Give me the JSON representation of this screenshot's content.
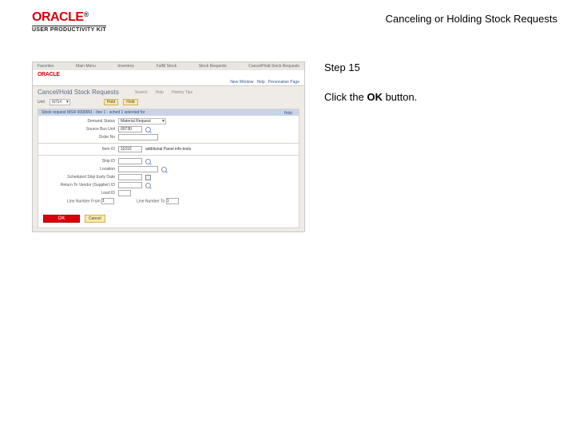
{
  "header": {
    "brand": "ORACLE",
    "subbrand": "USER PRODUCTIVITY KIT",
    "title": "Canceling or Holding Stock Requests"
  },
  "instruction": {
    "step_label": "Step 15",
    "text_pre": "Click the ",
    "bold": "OK",
    "text_post": " button."
  },
  "shot": {
    "menu_items": [
      "Favorites",
      "Main Menu",
      "Inventory",
      "Fulfill Stock",
      "Stock Requests",
      "Cancel/Hold Stock Requests"
    ],
    "brand": "ORACLE",
    "sub_links": [
      "New Window",
      "Help",
      "Personalize Page"
    ],
    "page_title": "Cancel/Hold Stock Requests",
    "tabs": [
      "Search",
      "Help",
      "History Tips"
    ],
    "bar_unit_label": "Unit",
    "bar_unit_value": "W/S4",
    "bar_buttons": [
      "Hold",
      "Hold"
    ],
    "form_header": "Stock request MSR 0000001 - line 1 - sched 1 selected for",
    "right_link": "Help",
    "rows": {
      "demand_status": {
        "label": "Demand Status",
        "value": "Material Request"
      },
      "source_bu": {
        "label": "Source Bus Unit",
        "value": "00730"
      },
      "order_no": {
        "label": "Order No"
      },
      "item_id": {
        "label": "Item ID",
        "value": "11010",
        "note": "additional Panel info-tests"
      },
      "ship_id": {
        "label": "Ship ID"
      },
      "location": {
        "label": "Location"
      },
      "sched_ship": {
        "label": "Scheduled Ship Early Date"
      },
      "rtv_id": {
        "label": "Return To Vendor (Supplier) ID"
      },
      "load_id": {
        "label": "Load ID"
      },
      "line_from": {
        "label": "Line Number From",
        "value": "1"
      },
      "line_to": {
        "label": "Line Number To",
        "value": "1"
      }
    },
    "ok_label": "OK",
    "cancel_label": "Cancel"
  }
}
